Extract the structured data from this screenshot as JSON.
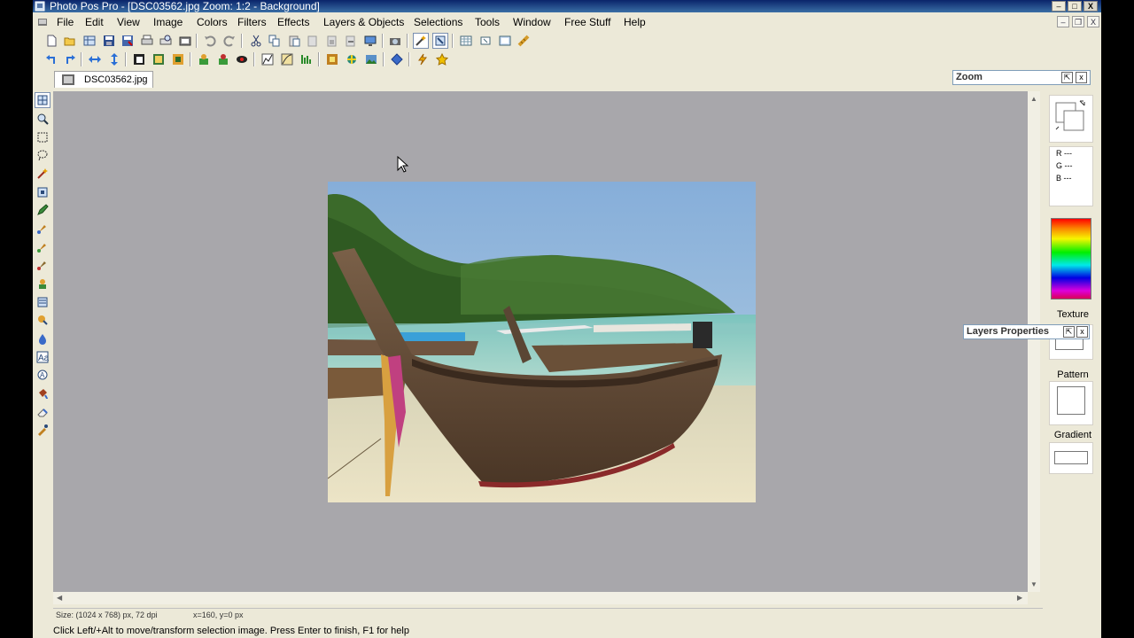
{
  "window": {
    "title": "Photo Pos Pro - [DSC03562.jpg  Zoom: 1:2 - Background]",
    "minimize": "–",
    "maximize": "□",
    "close": "X"
  },
  "menu": {
    "items": [
      "File",
      "Edit",
      "View",
      "Image",
      "Colors",
      "Filters",
      "Effects",
      "Layers & Objects",
      "Selections",
      "Tools",
      "Window",
      "Free Stuff",
      "Help"
    ]
  },
  "mdi": {
    "minimize": "–",
    "restore": "❐",
    "close": "X"
  },
  "document": {
    "tab_label": "DSC03562.jpg"
  },
  "zoom_panel": {
    "title": "Zoom",
    "pin": "⇱",
    "close": "x"
  },
  "layers_panel": {
    "title": "Layers Properties",
    "pin": "⇱",
    "close": "x"
  },
  "right_panel": {
    "r": "R ---",
    "g": "G ---",
    "b": "B ---",
    "texture_label": "Texture",
    "pattern_label": "Pattern",
    "gradient_label": "Gradient"
  },
  "status": {
    "size": "Size: (1024 x 768) px, 72 dpi",
    "coords": "x=160, y=0 px",
    "hint": "Click Left/+Alt to move/transform selection image. Press Enter to finish, F1 for help"
  },
  "icons": {
    "toolbar1": [
      "new-icon",
      "open-icon",
      "browse-icon",
      "save-icon",
      "save-as-icon",
      "print-icon",
      "print-preview-icon",
      "scan-icon",
      "undo-icon",
      "redo-icon",
      "cut-icon",
      "copy-icon",
      "paste-icon",
      "paste-new-icon",
      "paste-into-icon",
      "paste-layer-icon",
      "screen-capture-icon",
      "camera-icon",
      "magic-tool-icon",
      "move-transform-icon",
      "grid-icon",
      "rotate-view-icon",
      "frame-icon",
      "ruler-icon"
    ],
    "toolbar2": [
      "rotate-left-icon",
      "rotate-right-icon",
      "flip-horizontal-icon",
      "flip-vertical-icon",
      "resize-icon",
      "canvas-size-icon",
      "crop-icon",
      "brightness-icon",
      "color-balance-icon",
      "red-eye-icon",
      "levels-icon",
      "curves-icon",
      "sharpen-icon",
      "frame-effect-icon",
      "effects-icon",
      "picture-icon",
      "diamond-icon",
      "lightning-icon",
      "star-icon"
    ],
    "tools": [
      "move-tool-icon",
      "zoom-tool-icon",
      "rect-select-icon",
      "lasso-icon",
      "magic-wand-icon",
      "transform-icon",
      "pencil-icon",
      "brush-icon",
      "airbrush-icon",
      "stamp-icon",
      "clone-icon",
      "gradient-tool-icon",
      "smudge-icon",
      "blur-icon",
      "text-tool-icon",
      "shape-tool-icon",
      "fill-tool-icon",
      "eraser-icon",
      "color-picker-icon"
    ]
  }
}
